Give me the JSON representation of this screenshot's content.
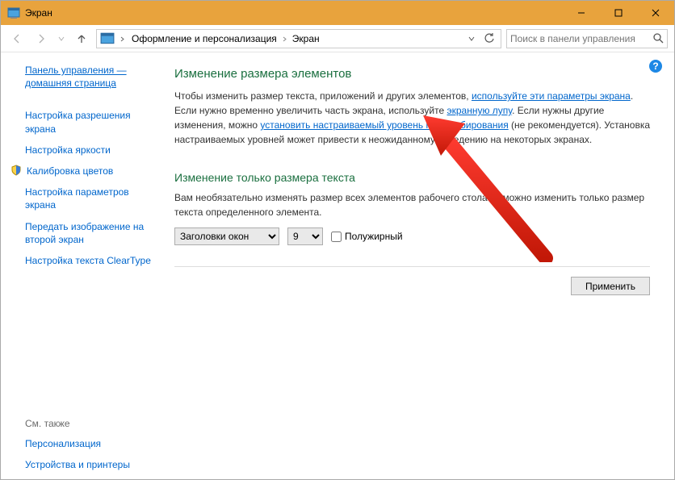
{
  "window": {
    "title": "Экран"
  },
  "breadcrumb": {
    "seg1": "Оформление и персонализация",
    "seg2": "Экран"
  },
  "search": {
    "placeholder": "Поиск в панели управления"
  },
  "sidebar": {
    "home": "Панель управления — домашняя страница",
    "items": [
      "Настройка разрешения экрана",
      "Настройка яркости",
      "Калибровка цветов",
      "Настройка параметров экрана",
      "Передать изображение на второй экран",
      "Настройка текста ClearType"
    ],
    "seealso_heading": "См. также",
    "seealso": [
      "Персонализация",
      "Устройства и принтеры"
    ]
  },
  "main": {
    "heading1": "Изменение размера элементов",
    "para1_a": "Чтобы изменить размер текста, приложений и других элементов, ",
    "link1": "используйте эти параметры экрана",
    "para1_b": ". Если нужно временно увеличить часть экрана, используйте ",
    "link2": "экранную лупу",
    "para1_c": ". Если нужны другие изменения, можно ",
    "link3": "установить настраиваемый уровень масштабирования",
    "para1_d": " (не рекомендуется). Установка настраиваемых уровней может привести к неожиданному поведению на некоторых экранах.",
    "heading2": "Изменение только размера текста",
    "para2": "Вам необязательно изменять размер всех элементов рабочего стола — можно изменить только размер текста определенного элемента.",
    "select_element": "Заголовки окон",
    "select_size": "9",
    "bold_label": "Полужирный",
    "apply": "Применить"
  }
}
